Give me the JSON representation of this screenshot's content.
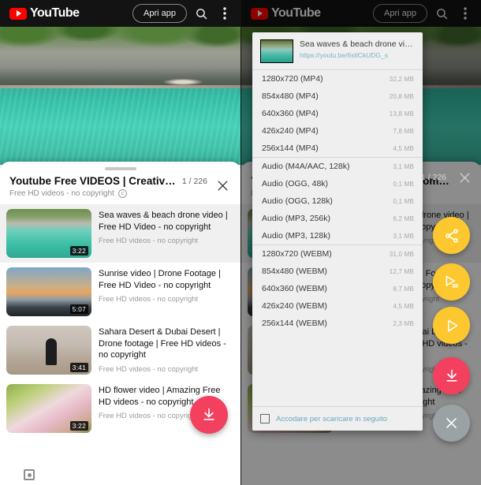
{
  "topbar": {
    "logo_word": "YouTube",
    "logo_icon": "youtube-play-icon",
    "open_app_label": "Apri app",
    "search_icon": "search-icon",
    "overflow_icon": "more-vertical-icon"
  },
  "sheet": {
    "playlist_title": "Youtube Free VIDEOS | Creative Com…",
    "playlist_subtitle": "Free HD videos - no copyright",
    "cc_badge": "cc-icon",
    "counter": "1 / 226",
    "close_icon": "close-icon",
    "videos": [
      {
        "title": "Sea waves & beach drone video | Free HD Video - no copyright",
        "channel": "Free HD videos - no copyright",
        "duration": "3:22",
        "thumb_class": "t-sea",
        "active": true
      },
      {
        "title": "Sunrise video | Drone Footage | Free HD Video - no copyright",
        "channel": "Free HD videos - no copyright",
        "duration": "5:07",
        "thumb_class": "t-sunrise",
        "active": false
      },
      {
        "title": "Sahara Desert & Dubai Desert | Drone footage | Free HD videos - no copyright",
        "channel": "Free HD videos - no copyright",
        "duration": "3:41",
        "thumb_class": "t-desert",
        "active": false
      },
      {
        "title": "HD flower video | Amazing Free HD videos - no copyright",
        "channel": "Free HD videos - no copyright",
        "duration": "3:22",
        "thumb_class": "t-flower",
        "active": false
      }
    ]
  },
  "fabs": {
    "download_left": "download-icon",
    "share": "share-icon",
    "queue": "play-queue-icon",
    "play": "play-icon",
    "download": "download-icon",
    "close": "close-icon",
    "colors": {
      "yellow": "#fdc82f",
      "red": "#f2405e",
      "grey": "#9aa2a4"
    }
  },
  "navbar": {
    "recents_icon": "recents-square-icon"
  },
  "dialog": {
    "video_title": "Sea waves & beach drone video..",
    "video_url": "https://youtu.be/6stlCkUDG_s",
    "thumbnail_icon": "video-thumbnail",
    "groups": [
      {
        "name": "mp4",
        "options": [
          {
            "label": "1280x720 (MP4)",
            "size": "32,2 MB"
          },
          {
            "label": "854x480 (MP4)",
            "size": "20,8 MB"
          },
          {
            "label": "640x360 (MP4)",
            "size": "13,8 MB"
          },
          {
            "label": "426x240 (MP4)",
            "size": "7,8 MB"
          },
          {
            "label": "256x144 (MP4)",
            "size": "4,5 MB"
          }
        ]
      },
      {
        "name": "audio",
        "options": [
          {
            "label": "Audio (M4A/AAC, 128k)",
            "size": "3,1 MB"
          },
          {
            "label": "Audio (OGG, 48k)",
            "size": "0,1 MB"
          },
          {
            "label": "Audio (OGG, 128k)",
            "size": "0,1 MB"
          },
          {
            "label": "Audio (MP3, 256k)",
            "size": "6,2 MB"
          },
          {
            "label": "Audio (MP3, 128k)",
            "size": "3,1 MB"
          }
        ]
      },
      {
        "name": "webm",
        "options": [
          {
            "label": "1280x720 (WEBM)",
            "size": "31,0 MB"
          },
          {
            "label": "854x480 (WEBM)",
            "size": "12,7 MB"
          },
          {
            "label": "640x360 (WEBM)",
            "size": "8,7 MB"
          },
          {
            "label": "426x240 (WEBM)",
            "size": "4,5 MB"
          },
          {
            "label": "256x144 (WEBM)",
            "size": "2,3 MB"
          }
        ]
      }
    ],
    "queue_checkbox_label": "Accodare per scaricare in seguito",
    "queue_checkbox_checked": false
  }
}
